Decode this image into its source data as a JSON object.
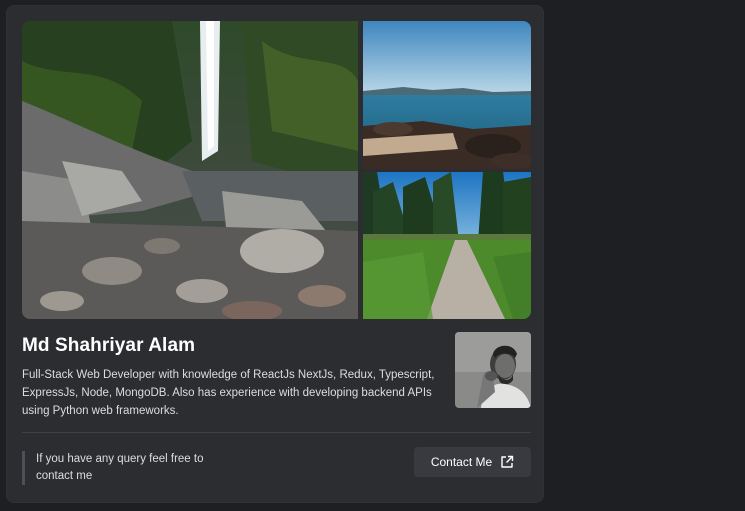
{
  "profile": {
    "name": "Md Shahriyar Alam",
    "bio": "Full-Stack Web Developer with knowledge of ReactJs NextJs, Redux, Typescript, ExpressJs, Node, MongoDB. Also has experience with developing backend APIs using Python web frameworks."
  },
  "footer": {
    "query_text": "If you have any query feel free to contact me",
    "contact_label": "Contact Me"
  },
  "gallery": {
    "images": [
      "waterfall-rocks",
      "coast-sea",
      "forest-path"
    ]
  },
  "colors": {
    "background": "#1e1f22",
    "card": "#2b2d31",
    "button": "#383a40",
    "text": "#dbdee1"
  }
}
